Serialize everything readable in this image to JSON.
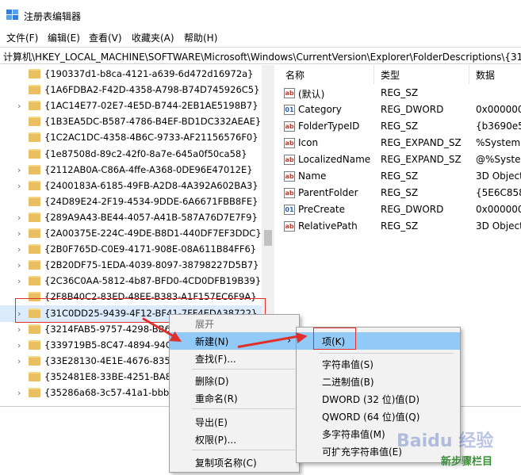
{
  "window": {
    "title": "注册表编辑器"
  },
  "menu": [
    "文件(F)",
    "编辑(E)",
    "查看(V)",
    "收藏夹(A)",
    "帮助(H)"
  ],
  "address": "计算机\\HKEY_LOCAL_MACHINE\\SOFTWARE\\Microsoft\\Windows\\CurrentVersion\\Explorer\\FolderDescriptions\\{31C",
  "tree": {
    "items": [
      "{190337d1-b8ca-4121-a639-6d472d16972a}",
      "{1A6FDBA2-F42D-4358-A798-B74D745926C5}",
      "{1AC14E77-02E7-4E5D-B744-2EB1AE5198B7}",
      "{1B3EA5DC-B587-4786-B4EF-BD1DC332AEAE}",
      "{1C2AC1DC-4358-4B6C-9733-AF21156576F0}",
      "{1e87508d-89c2-42f0-8a7e-645a0f50ca58}",
      "{2112AB0A-C86A-4ffe-A368-0DE96E47012E}",
      "{2400183A-6185-49FB-A2D8-4A392A602BA3}",
      "{24D89E24-2F19-4534-9DDE-6A6671FBB8FE}",
      "{289A9A43-BE44-4057-A41B-587A76D7E7F9}",
      "{2A00375E-224C-49DE-B8D1-440DF7EF3DDC}",
      "{2B0F765D-C0E9-4171-908E-08A611B84FF6}",
      "{2B20DF75-1EDA-4039-8097-38798227D5B7}",
      "{2C36C0AA-5812-4b87-BFD0-4CD0DFB19B39}",
      "{2F8B40C2-83ED-48EE-B383-A1F157EC6F9A}",
      "{31C0DD25-9439-4F12-BF41-7FF4EDA38722}",
      "{3214FAB5-9757-4298-BB6",
      "{339719B5-8C47-4894-94C",
      "{33E28130-4E1E-4676-835A",
      "{352481E8-33BE-4251-BA8",
      "{35286a68-3c57-41a1-bbb1"
    ]
  },
  "columns": {
    "name": "名称",
    "type": "类型",
    "data": "数据"
  },
  "values": [
    {
      "name": "(默认)",
      "type": "REG_SZ",
      "data": "",
      "icon": "string-value-icon"
    },
    {
      "name": "Category",
      "type": "REG_DWORD",
      "data": "0x0000000",
      "icon": "binary-value-icon"
    },
    {
      "name": "FolderTypeID",
      "type": "REG_SZ",
      "data": "{b3690e58",
      "icon": "string-value-icon"
    },
    {
      "name": "Icon",
      "type": "REG_EXPAND_SZ",
      "data": "%SystemR",
      "icon": "string-value-icon"
    },
    {
      "name": "LocalizedName",
      "type": "REG_EXPAND_SZ",
      "data": "@%Syster",
      "icon": "string-value-icon"
    },
    {
      "name": "Name",
      "type": "REG_SZ",
      "data": "3D Object",
      "icon": "string-value-icon"
    },
    {
      "name": "ParentFolder",
      "type": "REG_SZ",
      "data": "{5E6C858F",
      "icon": "string-value-icon"
    },
    {
      "name": "PreCreate",
      "type": "REG_DWORD",
      "data": "0x0000000",
      "icon": "binary-value-icon"
    },
    {
      "name": "RelativePath",
      "type": "REG_SZ",
      "data": "3D Object",
      "icon": "string-value-icon"
    }
  ],
  "context_menu": {
    "expand": "展开",
    "new": "新建(N)",
    "find": "查找(F)...",
    "delete": "删除(D)",
    "rename": "重命名(R)",
    "export": "导出(E)",
    "permissions": "权限(P)...",
    "copy_key_name": "复制项名称(C)"
  },
  "submenu": {
    "key": "项(K)",
    "string": "字符串值(S)",
    "binary": "二进制值(B)",
    "dword": "DWORD (32 位)值(D)",
    "qword": "QWORD (64 位)值(Q)",
    "multi_string": "多字符串值(M)",
    "expandable_string": "可扩充字符串值(E)"
  },
  "watermark": {
    "brand": "Baidu 经验",
    "caption": "新步骤栏目"
  },
  "colors": {
    "highlight": "#91c9f7",
    "annotation": "#e0302c",
    "folder": "#e8c062"
  }
}
